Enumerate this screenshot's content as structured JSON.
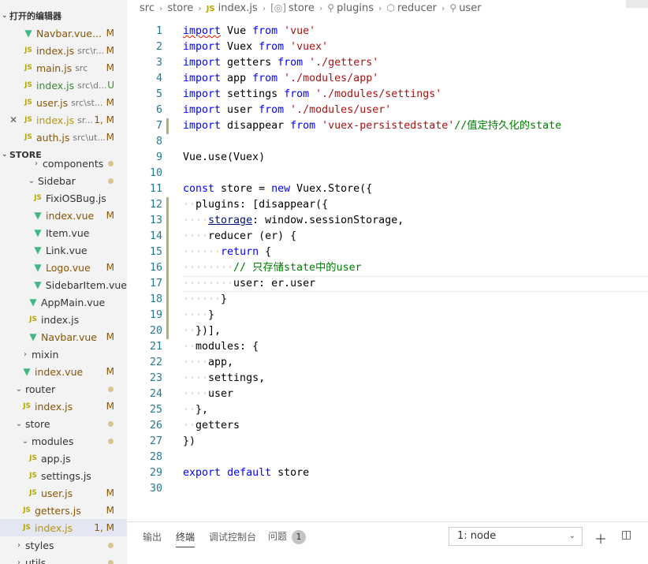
{
  "sidebar": {
    "open_editors_title": "打开的编辑器",
    "open_editors": [
      {
        "icon": "vue",
        "name": "Navbar.vue...",
        "desc": "",
        "badge": "M"
      },
      {
        "icon": "js",
        "name": "index.js",
        "desc": "src\\r...",
        "badge": "M"
      },
      {
        "icon": "js",
        "name": "main.js",
        "desc": "src",
        "badge": "M"
      },
      {
        "icon": "js",
        "name": "index.js",
        "desc": "src\\d...",
        "badge": "U"
      },
      {
        "icon": "js",
        "name": "user.js",
        "desc": "src\\st...",
        "badge": "M"
      },
      {
        "icon": "js",
        "name": "index.js",
        "desc": "sr...",
        "badge": "1, M"
      },
      {
        "icon": "js",
        "name": "auth.js",
        "desc": "src\\ut...",
        "badge": "M"
      }
    ],
    "store_title": "STORE",
    "tree": [
      {
        "name": "components",
        "type": "folder"
      },
      {
        "name": "Sidebar",
        "type": "folder"
      },
      {
        "name": "FixiOSBug.js",
        "type": "js"
      },
      {
        "name": "index.vue",
        "type": "vue",
        "badge": "M"
      },
      {
        "name": "Item.vue",
        "type": "vue"
      },
      {
        "name": "Link.vue",
        "type": "vue"
      },
      {
        "name": "Logo.vue",
        "type": "vue",
        "badge": "M"
      },
      {
        "name": "SidebarItem.vue",
        "type": "vue"
      },
      {
        "name": "AppMain.vue",
        "type": "vue"
      },
      {
        "name": "index.js",
        "type": "js"
      },
      {
        "name": "Navbar.vue",
        "type": "vue",
        "badge": "M"
      },
      {
        "name": "mixin",
        "type": "folder"
      },
      {
        "name": "index.vue",
        "type": "vue",
        "badge": "M"
      },
      {
        "name": "router",
        "type": "folder"
      },
      {
        "name": "index.js",
        "type": "js",
        "badge": "M"
      },
      {
        "name": "store",
        "type": "folder"
      },
      {
        "name": "modules",
        "type": "folder"
      },
      {
        "name": "app.js",
        "type": "js"
      },
      {
        "name": "settings.js",
        "type": "js"
      },
      {
        "name": "user.js",
        "type": "js",
        "badge": "M"
      },
      {
        "name": "getters.js",
        "type": "js",
        "badge": "M"
      },
      {
        "name": "index.js",
        "type": "js",
        "badge": "1, M"
      },
      {
        "name": "styles",
        "type": "folder"
      },
      {
        "name": "utils",
        "type": "folder"
      }
    ]
  },
  "breadcrumb": [
    "src",
    "store",
    "index.js",
    "store",
    "plugins",
    "reducer",
    "user"
  ],
  "code_lines": [
    "import Vue from 'vue'",
    "import Vuex from 'vuex'",
    "import getters from './getters'",
    "import app from './modules/app'",
    "import settings from './modules/settings'",
    "import user from './modules/user'",
    "import disappear from 'vuex-persistedstate'//值定持久化的state",
    "",
    "Vue.use(Vuex)",
    "",
    "const store = new Vuex.Store({",
    "  plugins: [disappear({",
    "    storage: window.sessionStorage,",
    "    reducer (er) {",
    "      return {",
    "        // 只存储state中的user",
    "        user: er.user",
    "      }",
    "    }",
    "  })],",
    "  modules: {",
    "    app,",
    "    settings,",
    "    user",
    "  },",
    "  getters",
    "})",
    "",
    "export default store",
    ""
  ],
  "panel": {
    "tabs": [
      "输出",
      "终端",
      "调试控制台",
      "问题"
    ],
    "problems_count": "1",
    "terminal_select": "1: node"
  },
  "colors": {
    "keyword": "#0000ff",
    "string": "#a31515",
    "comment": "#008000",
    "line_number": "#237893"
  }
}
